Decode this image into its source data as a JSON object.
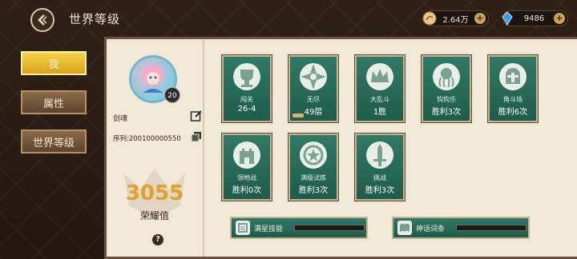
{
  "header": {
    "title": "世界等级",
    "currencies": [
      {
        "amount": "2.64万",
        "icon": "coin-icon"
      },
      {
        "amount": "9486",
        "icon": "blue-crystal-icon"
      }
    ]
  },
  "tabs": [
    {
      "label": "我",
      "active": true
    },
    {
      "label": "属性",
      "active": false
    },
    {
      "label": "世界等级",
      "active": false
    }
  ],
  "profile": {
    "level": "20",
    "name": "剑魂",
    "serial": "序列:200100000550",
    "honor_value": "3055",
    "honor_label": "荣耀值",
    "help": "?"
  },
  "cards": [
    {
      "name": "闯关",
      "value": "26-4",
      "icon": "trophy-icon"
    },
    {
      "name": "无尽",
      "value": "49层",
      "icon": "compass-star-icon",
      "progress": 0.2
    },
    {
      "name": "大乱斗",
      "value": "1胜",
      "icon": "crown-icon"
    },
    {
      "name": "钩钩乐",
      "value": "胜利3次",
      "icon": "octopus-icon"
    },
    {
      "name": "角斗场",
      "value": "胜利6次",
      "icon": "helmet-icon"
    },
    {
      "name": "领地战",
      "value": "胜利0次",
      "icon": "castle-icon"
    },
    {
      "name": "满级试炼",
      "value": "胜利3次",
      "icon": "star-emblem-icon"
    },
    {
      "name": "挑战",
      "value": "胜利3次",
      "icon": "sword-icon"
    }
  ],
  "skills": [
    {
      "label": "满星技能",
      "icon": "scroll-icon",
      "progress": 0
    },
    {
      "label": "神话词条",
      "icon": "book-icon",
      "progress": 0
    }
  ],
  "colors": {
    "active_tab": "#f2c33a",
    "card_bg": "#2a6e5c",
    "honor": "#e0a12e"
  }
}
